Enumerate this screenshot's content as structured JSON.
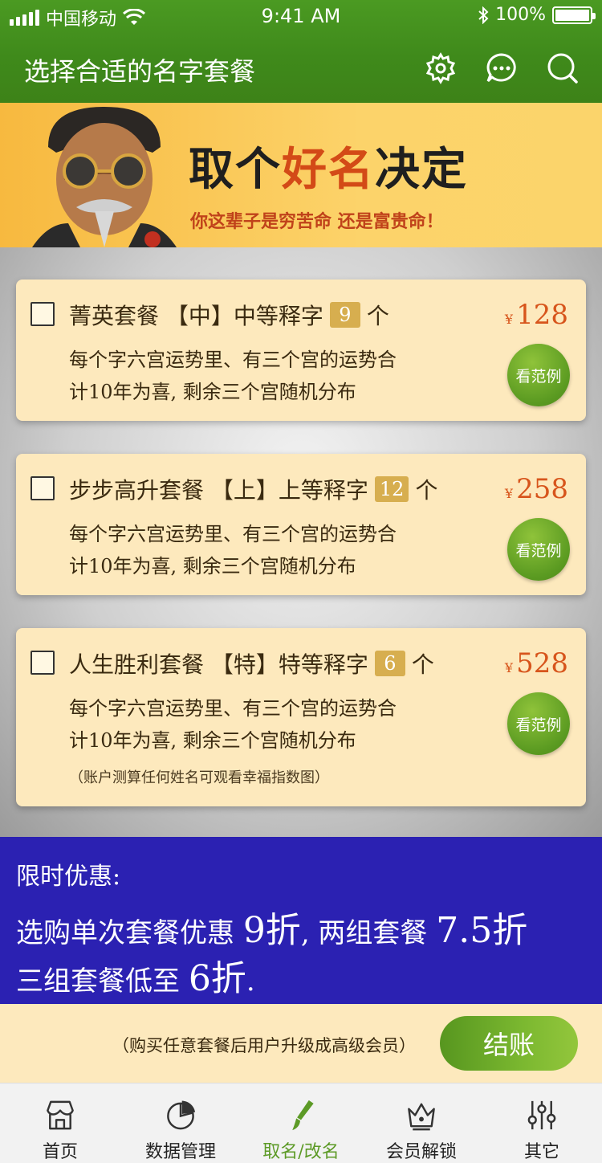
{
  "status_bar": {
    "carrier": "中国移动",
    "time": "9:41 AM",
    "battery": "100%"
  },
  "header": {
    "title": "选择合适的名字套餐"
  },
  "banner": {
    "headline_part1": "取个",
    "headline_highlight": "好名",
    "headline_part2": "决定",
    "subtitle": "你这辈子是穷苦命 还是富贵命！"
  },
  "packages": [
    {
      "name": "菁英套餐 【中】中等释字",
      "count": "9",
      "unit": "个",
      "currency": "¥",
      "price": "128",
      "desc_line1": "每个字六宫运势里、有三个宫的运势合",
      "desc_line2": "计10年为喜, 剩余三个宫随机分布",
      "button": "看范例"
    },
    {
      "name": "步步高升套餐 【上】上等释字",
      "count": "12",
      "unit": "个",
      "currency": "¥",
      "price": "258",
      "desc_line1": "每个字六宫运势里、有三个宫的运势合",
      "desc_line2": "计10年为喜, 剩余三个宫随机分布",
      "button": "看范例"
    },
    {
      "name": "人生胜利套餐 【特】特等释字",
      "count": "6",
      "unit": "个",
      "currency": "¥",
      "price": "528",
      "desc_line1": "每个字六宫运势里、有三个宫的运势合",
      "desc_line2": "计10年为喜, 剩余三个宫随机分布",
      "note": "（账户测算任何姓名可观看幸福指数图）",
      "button": "看范例"
    }
  ],
  "promo": {
    "heading": "限时优惠:",
    "line1_a": "选购单次套餐优惠 ",
    "line1_b": "9折",
    "line1_c": ", 两组套餐 ",
    "line1_d": "7.5折",
    "line2_a": "三组套餐低至 ",
    "line2_b": "6折",
    "line2_c": "."
  },
  "checkout": {
    "note": "（购买任意套餐后用户升级成高级会员）",
    "button": "结账"
  },
  "tabs": [
    {
      "label": "首页",
      "icon": "store-icon"
    },
    {
      "label": "数据管理",
      "icon": "pie-chart-icon"
    },
    {
      "label": "取名/改名",
      "icon": "brush-icon"
    },
    {
      "label": "会员解锁",
      "icon": "crown-lock-icon"
    },
    {
      "label": "其它",
      "icon": "sliders-icon"
    }
  ],
  "colors": {
    "header_green": "#4b9a22",
    "promo_blue": "#2b21b2",
    "price_orange": "#d7551c",
    "card_bg": "#fde9bd"
  }
}
